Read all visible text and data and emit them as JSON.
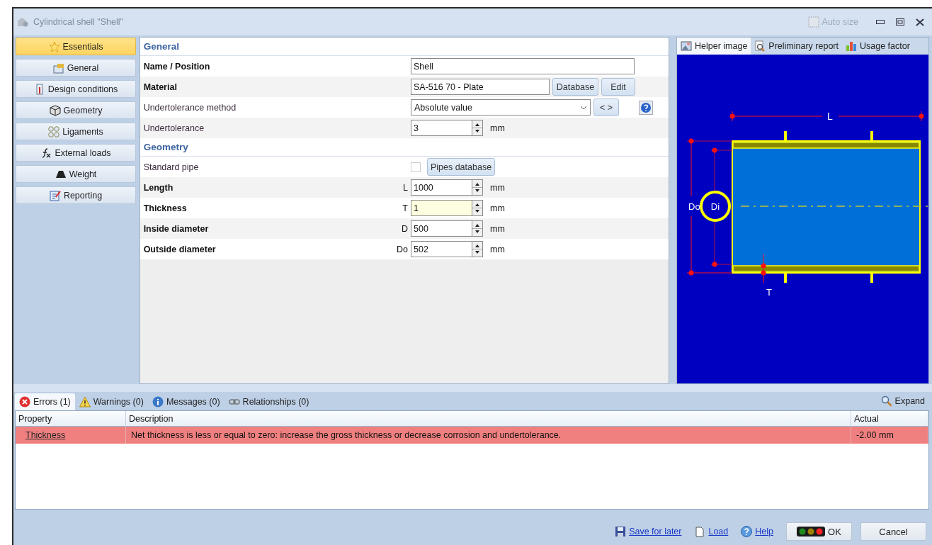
{
  "window": {
    "title": "Cylindrical shell \"Shell\"",
    "auto_size": "Auto size"
  },
  "sidebar": {
    "items": [
      {
        "label": "Essentials",
        "selected": true
      },
      {
        "label": "General",
        "selected": false
      },
      {
        "label": "Design conditions",
        "selected": false
      },
      {
        "label": "Geometry",
        "selected": false
      },
      {
        "label": "Ligaments",
        "selected": false
      },
      {
        "label": "External loads",
        "selected": false
      },
      {
        "label": "Weight",
        "selected": false
      },
      {
        "label": "Reporting",
        "selected": false
      }
    ]
  },
  "sections": [
    {
      "title": "General",
      "rows": [
        {
          "kind": "text",
          "label": "Name / Position",
          "bold": true,
          "value": "Shell"
        },
        {
          "kind": "material",
          "label": "Material",
          "bold": true,
          "value": "SA-516 70 - Plate",
          "buttons": [
            "Database",
            "Edit"
          ]
        },
        {
          "kind": "select",
          "label": "Undertolerance method",
          "bold": false,
          "value": "Absolute value",
          "nav": "< >"
        },
        {
          "kind": "number",
          "label": "Undertolerance",
          "bold": false,
          "value": "3",
          "unit": "mm",
          "highlighted": false
        }
      ]
    },
    {
      "title": "Geometry",
      "rows": [
        {
          "kind": "checkbox",
          "label": "Standard pipe",
          "bold": false,
          "checked": false,
          "button": "Pipes database"
        },
        {
          "kind": "number",
          "label": "Length",
          "bold": true,
          "symbol": "L",
          "value": "1000",
          "unit": "mm",
          "highlighted": false
        },
        {
          "kind": "number",
          "label": "Thickness",
          "bold": true,
          "symbol": "T",
          "value": "1",
          "unit": "mm",
          "highlighted": true
        },
        {
          "kind": "number",
          "label": "Inside diameter",
          "bold": true,
          "symbol": "D",
          "value": "500",
          "unit": "mm",
          "highlighted": false
        },
        {
          "kind": "number",
          "label": "Outside diameter",
          "bold": true,
          "symbol": "Do",
          "value": "502",
          "unit": "mm",
          "highlighted": false
        }
      ]
    }
  ],
  "helper_tabs": [
    {
      "label": "Helper image",
      "selected": true
    },
    {
      "label": "Preliminary report",
      "selected": false
    },
    {
      "label": "Usage factor",
      "selected": false
    }
  ],
  "diagram_labels": {
    "length": "L",
    "outer": "Do",
    "inner": "Di",
    "thickness": "T"
  },
  "messages": {
    "tabs": [
      {
        "label": "Errors (1)",
        "selected": true
      },
      {
        "label": "Warnings (0)",
        "selected": false
      },
      {
        "label": "Messages (0)",
        "selected": false
      },
      {
        "label": "Relationships (0)",
        "selected": false
      }
    ],
    "expand": "Expand",
    "columns": [
      "Property",
      "Description",
      "Actual"
    ],
    "rows": [
      {
        "property": "Thickness",
        "description": "Net thickness is less or equal to zero: increase the gross thickness or decrease corrosion and undertolerance.",
        "actual": "-2.00 mm"
      }
    ]
  },
  "footer": {
    "links": [
      "Save for later",
      "Load",
      "Help"
    ],
    "ok": "OK",
    "cancel": "Cancel"
  }
}
